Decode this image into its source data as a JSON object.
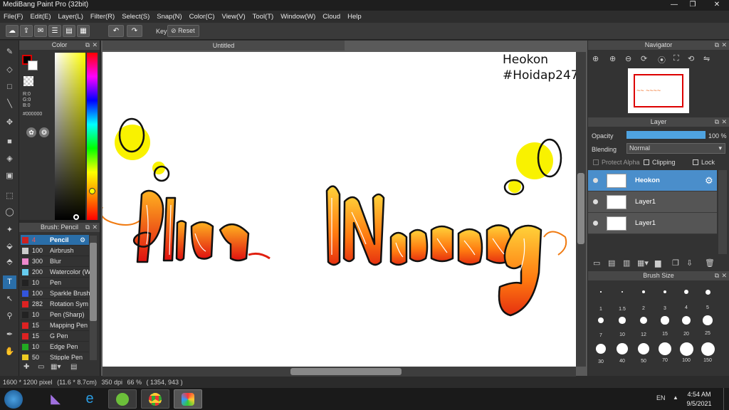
{
  "window": {
    "title": "MediBang Paint Pro (32bit)",
    "minimize": "—",
    "maximize": "❐",
    "close": "✕"
  },
  "menu": [
    "File(F)",
    "Edit(E)",
    "Layer(L)",
    "Filter(R)",
    "Select(S)",
    "Snap(N)",
    "Color(C)",
    "View(V)",
    "Tool(T)",
    "Window(W)",
    "Cloud",
    "Help"
  ],
  "toolbar": {
    "key_label": "Key",
    "reset_label": "Reset"
  },
  "color_panel": {
    "title": "Color",
    "r": "R:0",
    "g": "G:0",
    "b": "B:0",
    "hex": "#000000"
  },
  "brush_panel": {
    "title": "Brush: Pencil",
    "items": [
      {
        "size": "4",
        "name": "Pencil",
        "color": "#cc2222",
        "selected": true
      },
      {
        "size": "100",
        "name": "Airbrush",
        "color": "#cccccc"
      },
      {
        "size": "300",
        "name": "Blur",
        "color": "#ee88cc"
      },
      {
        "size": "200",
        "name": "Watercolor (W",
        "color": "#66ccee"
      },
      {
        "size": "10",
        "name": "Pen",
        "color": "#222222"
      },
      {
        "size": "100",
        "name": "Sparkle Brush",
        "color": "#3355dd"
      },
      {
        "size": "282",
        "name": "Rotation Sym",
        "color": "#dd2222"
      },
      {
        "size": "10",
        "name": "Pen (Sharp)",
        "color": "#222222"
      },
      {
        "size": "15",
        "name": "Mapping Pen",
        "color": "#dd2222"
      },
      {
        "size": "15",
        "name": "G Pen",
        "color": "#dd2222"
      },
      {
        "size": "10",
        "name": "Edge Pen",
        "color": "#22aa22"
      },
      {
        "size": "50",
        "name": "Stipple Pen",
        "color": "#eecc22"
      }
    ]
  },
  "document": {
    "tab_title": "Untitled",
    "watermark_line1": "Heokon",
    "watermark_line2": "#Hoidap247"
  },
  "navigator": {
    "title": "Navigator"
  },
  "layer_panel": {
    "title": "Layer",
    "opacity_label": "Opacity",
    "opacity_value": "100 %",
    "opacity_fraction": 1.0,
    "blending_label": "Blending",
    "blending_value": "Normal",
    "protect_alpha": "Protect Alpha",
    "clipping": "Clipping",
    "lock": "Lock",
    "layers": [
      {
        "name": "Heokon",
        "selected": true
      },
      {
        "name": "Layer1",
        "selected": false
      },
      {
        "name": "Layer1",
        "selected": false
      }
    ]
  },
  "brush_size": {
    "title": "Brush Size",
    "sizes": [
      "1",
      "1.5",
      "2",
      "3",
      "4",
      "5",
      "7",
      "10",
      "12",
      "15",
      "20",
      "25",
      "30",
      "40",
      "50",
      "70",
      "100",
      "150"
    ]
  },
  "status": {
    "dimensions": "1600 * 1200 pixel",
    "cm": "(11.6 * 8.7cm)",
    "dpi": "350 dpi",
    "zoom": "66 %",
    "cursor": "( 1354, 943 )"
  },
  "taskbar": {
    "lang": "EN",
    "time": "4:54 AM",
    "date": "9/5/2021"
  }
}
